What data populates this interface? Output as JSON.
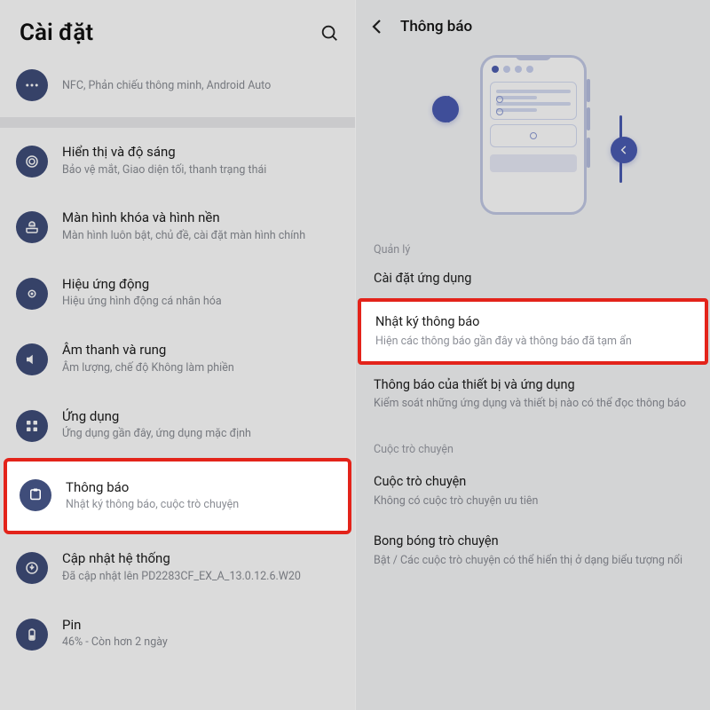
{
  "left": {
    "title": "Cài đặt",
    "conn_sub": "NFC, Phản chiếu thông minh, Android Auto",
    "items": [
      {
        "title": "Hiển thị và độ sáng",
        "sub": "Bảo vệ mắt, Giao diện tối, thanh trạng thái"
      },
      {
        "title": "Màn hình khóa và hình nền",
        "sub": "Màn hình luôn bật, chủ đề, cài đặt màn hình chính"
      },
      {
        "title": "Hiệu ứng động",
        "sub": "Hiệu ứng hình động cá nhân hóa"
      },
      {
        "title": "Âm thanh và rung",
        "sub": "Âm lượng, chế độ Không làm phiền"
      },
      {
        "title": "Ứng dụng",
        "sub": "Ứng dụng gần đây, ứng dụng mặc định"
      },
      {
        "title": "Thông báo",
        "sub": "Nhật ký thông báo, cuộc trò chuyện"
      },
      {
        "title": "Cập nhật hệ thống",
        "sub": "Đã cập nhật lên PD2283CF_EX_A_13.0.12.6.W20"
      },
      {
        "title": "Pin",
        "sub": "46% - Còn hơn 2 ngày"
      }
    ]
  },
  "right": {
    "title": "Thông báo",
    "section_manage": "Quản lý",
    "app_settings": "Cài đặt ứng dụng",
    "rows": [
      {
        "title": "Nhật ký thông báo",
        "sub": "Hiện các thông báo gần đây và thông báo đã tạm ẩn"
      },
      {
        "title": "Thông báo của thiết bị và ứng dụng",
        "sub": "Kiểm soát những ứng dụng và thiết bị nào có thể đọc thông báo"
      }
    ],
    "section_conv": "Cuộc trò chuyện",
    "conv_rows": [
      {
        "title": "Cuộc trò chuyện",
        "sub": "Không có cuộc trò chuyện ưu tiên"
      },
      {
        "title": "Bong bóng trò chuyện",
        "sub": "Bật / Các cuộc trò chuyện có thể hiển thị ở dạng biểu tượng nổi"
      }
    ]
  }
}
